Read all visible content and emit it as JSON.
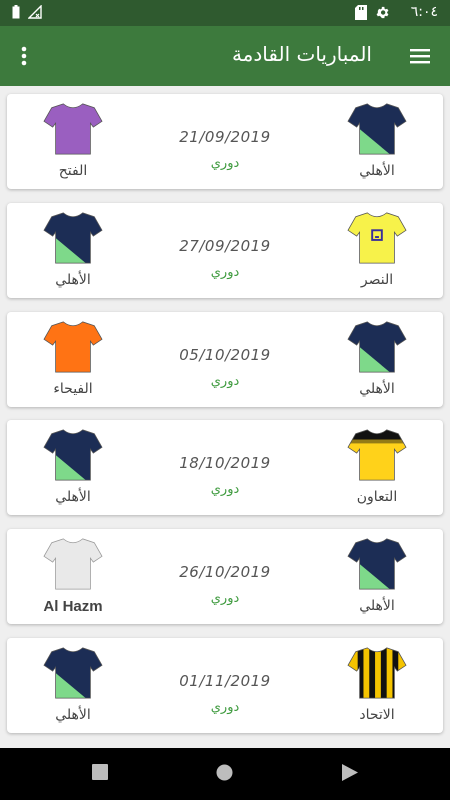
{
  "status_bar": {
    "time": "٦:٠٤",
    "icons": [
      "settings-icon",
      "sd-card-icon",
      "no-signal-icon",
      "battery-icon"
    ]
  },
  "app_bar": {
    "title": "المباريات القادمة",
    "icons": [
      "menu-icon",
      "more-vert-icon"
    ]
  },
  "matches": [
    {
      "date": "21/09/2019",
      "competition": "دوري",
      "home": {
        "name": "الأهلي",
        "shirt": "navy-green-diagonal"
      },
      "away": {
        "name": "الفتح",
        "shirt": "purple"
      }
    },
    {
      "date": "27/09/2019",
      "competition": "دوري",
      "home": {
        "name": "النصر",
        "shirt": "yellow-with-blue-badge"
      },
      "away": {
        "name": "الأهلي",
        "shirt": "navy-green-diagonal"
      }
    },
    {
      "date": "05/10/2019",
      "competition": "دوري",
      "home": {
        "name": "الأهلي",
        "shirt": "navy-green-diagonal"
      },
      "away": {
        "name": "الفيحاء",
        "shirt": "orange"
      }
    },
    {
      "date": "18/10/2019",
      "competition": "دوري",
      "home": {
        "name": "التعاون",
        "shirt": "yellow-black-collar"
      },
      "away": {
        "name": "الأهلي",
        "shirt": "navy-green-diagonal"
      }
    },
    {
      "date": "26/10/2019",
      "competition": "دوري",
      "home": {
        "name": "الأهلي",
        "shirt": "navy-green-diagonal"
      },
      "away": {
        "name": "Al Hazm",
        "shirt": "white"
      }
    },
    {
      "date": "01/11/2019",
      "competition": "دوري",
      "home": {
        "name": "الاتحاد",
        "shirt": "yellow-black-stripes"
      },
      "away": {
        "name": "الأهلي",
        "shirt": "navy-green-diagonal"
      }
    }
  ],
  "nav_bar": {
    "icons": [
      "recents-icon",
      "home-icon",
      "back-icon"
    ]
  },
  "colors": {
    "status_bar": "#2f5a2f",
    "app_bar": "#3d7a3d",
    "competition_text": "#3d9a3d",
    "background": "#efefef"
  }
}
